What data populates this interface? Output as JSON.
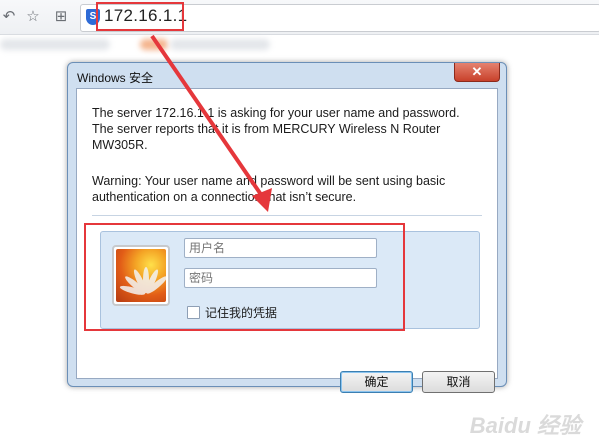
{
  "browser": {
    "url": "172.16.1.1",
    "shield_glyph": "S"
  },
  "dialog": {
    "title": "Windows 安全",
    "close_glyph": "✕",
    "message_lines": [
      "The server 172.16.1.1 is asking for your user name and password.",
      "The server reports that it is from MERCURY Wireless N Router",
      "MW305R."
    ],
    "warning_lines": [
      "Warning: Your user name and password will be sent using basic",
      "authentication on a connection that isn’t secure."
    ],
    "username_placeholder": "用户名",
    "password_placeholder": "密码",
    "remember_label": "记住我的凭据",
    "remember_checked": false,
    "ok_label": "确定",
    "cancel_label": "取消"
  },
  "watermark": "Baidu 经验",
  "colors": {
    "highlight": "#e5373b",
    "accent": "#2e6bd6"
  }
}
